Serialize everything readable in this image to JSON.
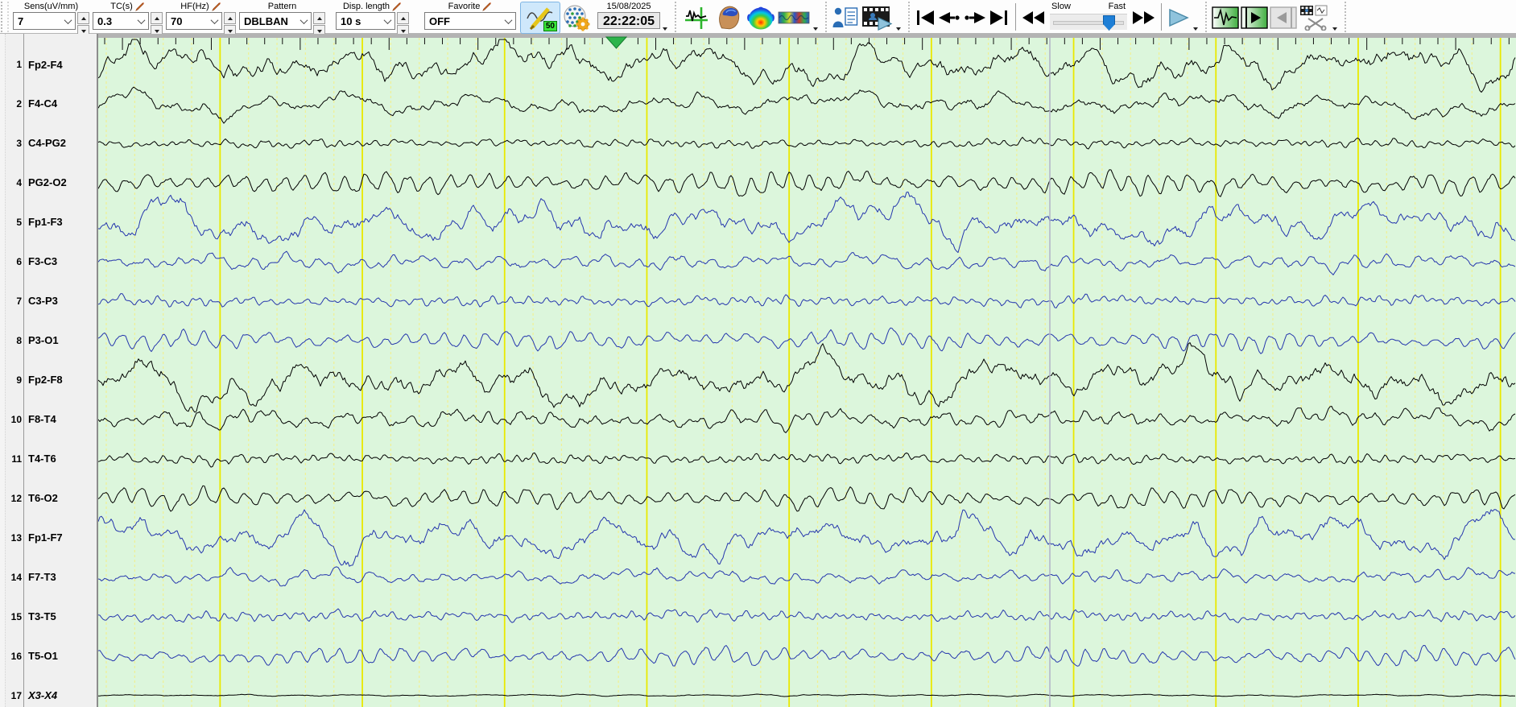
{
  "toolbar": {
    "sens": {
      "label": "Sens(uV/mm)",
      "value": "7"
    },
    "tc": {
      "label": "TC(s)",
      "value": "0.3"
    },
    "hf": {
      "label": "HF(Hz)",
      "value": "70"
    },
    "pattern": {
      "label": "Pattern",
      "value": "DBLBAN"
    },
    "disp": {
      "label": "Disp. length",
      "value": "10 s"
    },
    "favorite": {
      "label": "Favorite",
      "value": "OFF"
    },
    "notch": {
      "badge": "50"
    },
    "datetime": {
      "date": "15/08/2025",
      "time": "22:22:05"
    },
    "speed": {
      "slow": "Slow",
      "fast": "Fast"
    }
  },
  "channels": [
    {
      "n": "1",
      "label": "Fp2-F4",
      "color": "black",
      "amp": 26,
      "character": "slow"
    },
    {
      "n": "2",
      "label": "F4-C4",
      "color": "black",
      "amp": 15,
      "character": "slow"
    },
    {
      "n": "3",
      "label": "C4-PG2",
      "color": "black",
      "amp": 5,
      "character": "low"
    },
    {
      "n": "4",
      "label": "PG2-O2",
      "color": "black",
      "amp": 13,
      "character": "rhythm"
    },
    {
      "n": "5",
      "label": "Fp1-F3",
      "color": "blue",
      "amp": 24,
      "character": "slow"
    },
    {
      "n": "6",
      "label": "F3-C3",
      "color": "blue",
      "amp": 10,
      "character": "mid"
    },
    {
      "n": "7",
      "label": "C3-P3",
      "color": "blue",
      "amp": 6,
      "character": "low"
    },
    {
      "n": "8",
      "label": "P3-O1",
      "color": "blue",
      "amp": 11,
      "character": "rhythm"
    },
    {
      "n": "9",
      "label": "Fp2-F8",
      "color": "black",
      "amp": 26,
      "character": "slow"
    },
    {
      "n": "10",
      "label": "F8-T4",
      "color": "black",
      "amp": 12,
      "character": "mid"
    },
    {
      "n": "11",
      "label": "T4-T6",
      "color": "black",
      "amp": 6,
      "character": "low"
    },
    {
      "n": "12",
      "label": "T6-O2",
      "color": "black",
      "amp": 11,
      "character": "rhythm"
    },
    {
      "n": "13",
      "label": "Fp1-F7",
      "color": "blue",
      "amp": 24,
      "character": "slow"
    },
    {
      "n": "14",
      "label": "F7-T3",
      "color": "blue",
      "amp": 9,
      "character": "mid"
    },
    {
      "n": "15",
      "label": "T3-T5",
      "color": "blue",
      "amp": 6,
      "character": "low"
    },
    {
      "n": "16",
      "label": "T5-O1",
      "color": "blue",
      "amp": 10,
      "character": "rhythm"
    },
    {
      "n": "17",
      "label": "X3-X4",
      "color": "black",
      "amp": 0.8,
      "character": "flat",
      "italic": true
    }
  ],
  "colors": {
    "trace_black": "#000000",
    "trace_blue": "#2536ad",
    "bg_trace": "#dcf6dc",
    "grid_minor": "#f0f094",
    "grid_major": "#e9e900",
    "tick": "#111111",
    "ruler": "#b3b3b3",
    "cursor": "#b2b2c6",
    "marker": "#2db44a",
    "marker_edge": "#157a2e",
    "toggle_bg": "#cfe8fb",
    "slider_thumb": "#1e7fd6"
  }
}
